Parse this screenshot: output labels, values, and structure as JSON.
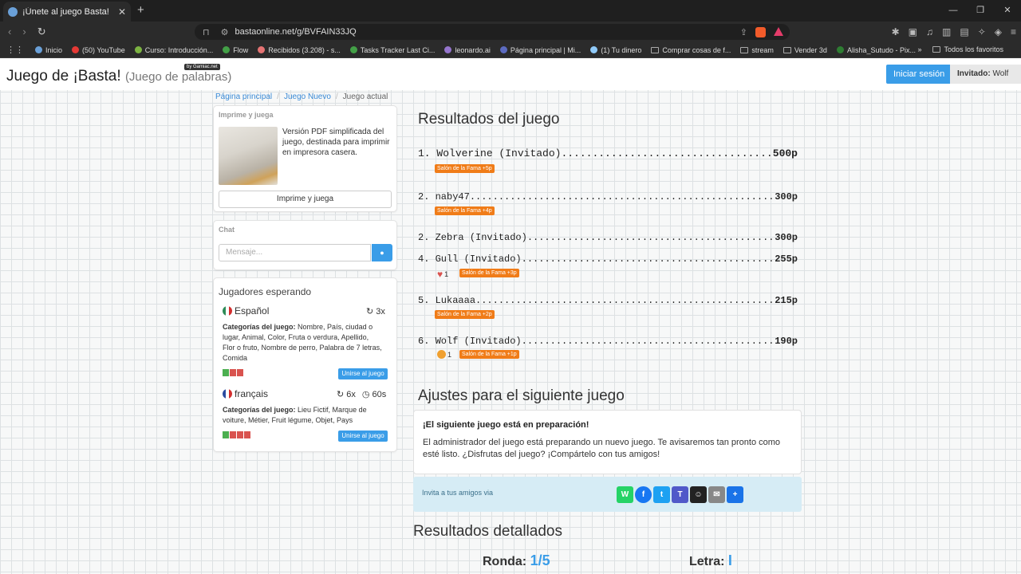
{
  "browser": {
    "tab_title": "¡Únete al juego Basta!",
    "tab_close": "✕",
    "new_tab": "+",
    "url": "bastaonline.net/g/BVFAIN33JQ",
    "bookmarks": [
      {
        "label": "Inicio",
        "color": "#6aa0d8"
      },
      {
        "label": "(50) YouTube",
        "color": "#e53935"
      },
      {
        "label": "Curso: Introducción...",
        "color": "#7cb342"
      },
      {
        "label": "Flow",
        "color": "#43a047"
      },
      {
        "label": "Recibidos (3.208) - s...",
        "color": "#e57373"
      },
      {
        "label": "Tasks Tracker Last Ci...",
        "color": "#43a047"
      },
      {
        "label": "leonardo.ai",
        "color": "#9575cd"
      },
      {
        "label": "Página principal | Mi...",
        "color": "#5c6bc0"
      },
      {
        "label": "(1) Tu dinero",
        "color": "#90caf9"
      },
      {
        "label": "Comprar cosas de f...",
        "color": "folder"
      },
      {
        "label": "stream",
        "color": "folder"
      },
      {
        "label": "Vender 3d",
        "color": "folder"
      },
      {
        "label": "Alisha_Sutudo - Pix...",
        "color": "#2e7d32"
      }
    ],
    "all_favorites": "Todos los favoritos"
  },
  "header": {
    "brand": "Juego de ¡Basta!",
    "brand_sub": "(Juego de palabras)",
    "badge": "by Gamiac.net",
    "login": "Iniciar sesión",
    "guest_label": "Invitado:",
    "guest_name": "Wolf"
  },
  "breadcrumb": {
    "home": "Página principal",
    "new_game": "Juego Nuevo",
    "current": "Juego actual"
  },
  "print_panel": {
    "title": "Imprime y juega",
    "text": "Versión PDF simplificada del juego, destinada para imprimir en impresora casera.",
    "button": "Imprime y juega"
  },
  "chat": {
    "title": "Chat",
    "placeholder": "Mensaje..."
  },
  "waiting": {
    "title": "Jugadores esperando",
    "games": [
      {
        "language": "Español",
        "rounds": "3x",
        "time": "",
        "categories_label": "Categorías del juego:",
        "categories": "Nombre, País, ciudad o lugar, Animal, Color, Fruta o verdura, Apellido, Flor o fruto, Nombre de perro, Palabra de 7 letras, Comida",
        "players": [
          "g",
          "r",
          "r"
        ],
        "join": "Unirse al juego"
      },
      {
        "language": "français",
        "rounds": "6x",
        "time": "60s",
        "categories_label": "Categorías del juego:",
        "categories": "Lieu Fictif, Marque de voiture, Métier, Fruit légume, Objet, Pays",
        "players": [
          "g",
          "r",
          "r",
          "r"
        ],
        "join": "Unirse al juego"
      }
    ]
  },
  "results": {
    "title": "Resultados del juego",
    "rows": [
      {
        "rank": "1.",
        "name": "Wolverine (Invitado)",
        "points": "500p",
        "likes": "",
        "fame": "Salón de la Fama +5p"
      },
      {
        "rank": "2.",
        "name": "naby47",
        "points": "300p",
        "likes": "",
        "fame": "Salón de la Fama +4p"
      },
      {
        "rank": "2.",
        "name": "Zebra (Invitado)",
        "points": "300p",
        "likes": "",
        "fame": ""
      },
      {
        "rank": "4.",
        "name": "Gull (Invitado)",
        "points": "255p",
        "likes": "1",
        "fame": "Salón de la Fama +3p"
      },
      {
        "rank": "5.",
        "name": "Lukaaaa",
        "points": "215p",
        "likes": "",
        "fame": "Salón de la Fama +2p"
      },
      {
        "rank": "6.",
        "name": "Wolf (Invitado)",
        "points": "190p",
        "likes": "1",
        "fame": "Salón de la Fama +1p"
      }
    ]
  },
  "next_game": {
    "title": "Ajustes para el siguiente juego",
    "heading": "¡El siguiente juego está en preparación!",
    "text": "El administrador del juego está preparando un nuevo juego. Te avisaremos tan pronto como esté listo. ¿Disfrutas del juego? ¡Compártelo con tus amigos!",
    "invite": "Invita a tus amigos via"
  },
  "detailed": {
    "title": "Resultados detallados",
    "round_label": "Ronda:",
    "round_value": "1/5",
    "letter_label": "Letra:",
    "letter_value": "I"
  },
  "colors": {
    "accent": "#3a9de8",
    "fame": "#f07c18",
    "whatsapp": "#25d366",
    "facebook": "#1877f2",
    "twitter": "#1da1f2",
    "teams": "#5059c9",
    "snapchat": "#222222",
    "email": "#888888",
    "share": "#1a73e8"
  }
}
